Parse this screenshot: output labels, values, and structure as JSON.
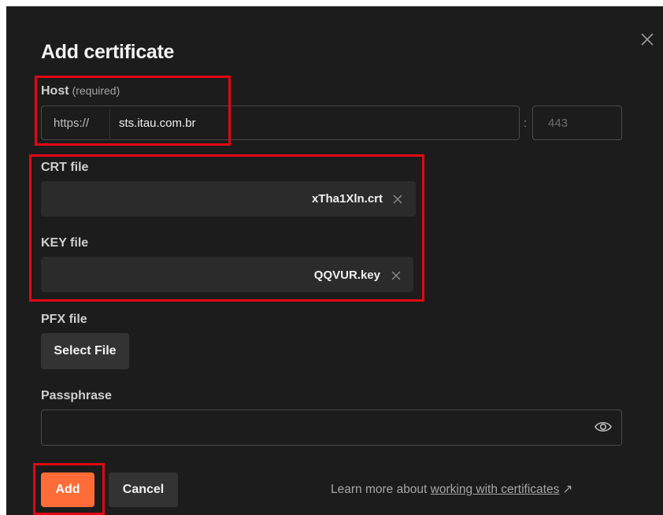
{
  "dialog": {
    "title": "Add certificate",
    "close_icon": "close-icon"
  },
  "host": {
    "label": "Host",
    "required_hint": "(required)",
    "protocol": "https://",
    "value": "sts.itau.com.br",
    "separator": ":",
    "port_placeholder": "443"
  },
  "crt": {
    "label": "CRT file",
    "filename": "xTha1Xln.crt",
    "remove_icon": "close-icon"
  },
  "key": {
    "label": "KEY file",
    "filename": "QQVUR.key",
    "remove_icon": "close-icon"
  },
  "pfx": {
    "label": "PFX file",
    "button_label": "Select File"
  },
  "passphrase": {
    "label": "Passphrase",
    "value": "",
    "toggle_icon": "eye-icon"
  },
  "footer": {
    "add_label": "Add",
    "cancel_label": "Cancel",
    "learn_prefix": "Learn more about",
    "learn_link": "working with certificates",
    "learn_arrow": "↗"
  },
  "colors": {
    "background": "#1c1c1c",
    "accent": "#ff6c37",
    "highlight": "#e30613"
  }
}
